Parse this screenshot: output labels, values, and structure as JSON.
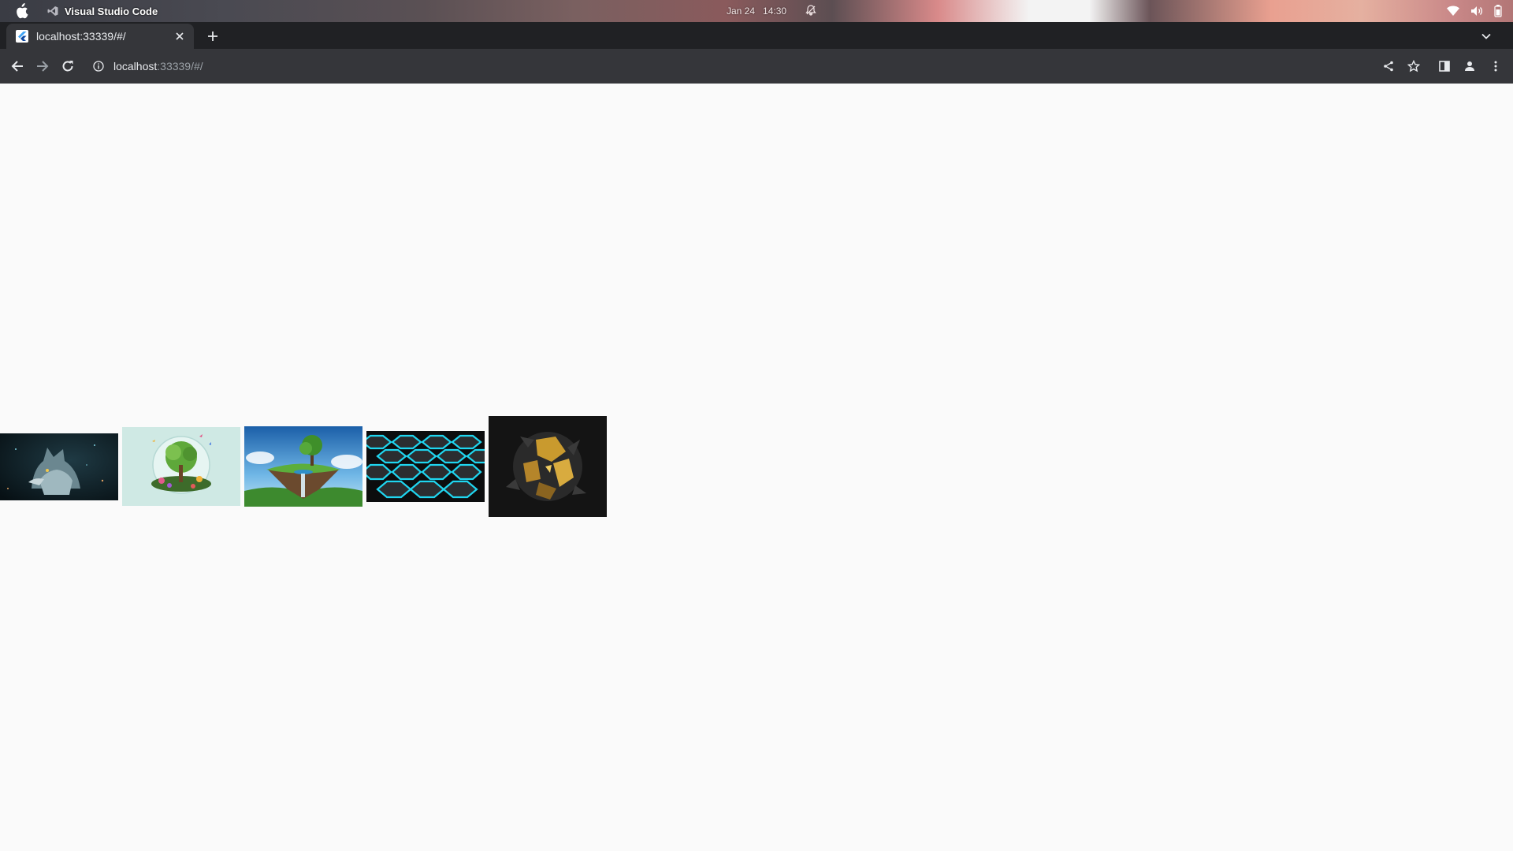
{
  "os_bar": {
    "app_name": "Visual Studio Code",
    "date": "Jan 24",
    "time": "14:30"
  },
  "browser": {
    "tab": {
      "title": "localhost:33339/#/"
    },
    "address": {
      "host": "localhost",
      "rest": ":33339/#/"
    }
  },
  "gallery": {
    "images": [
      {
        "subject": "wolf"
      },
      {
        "subject": "terrarium-globe"
      },
      {
        "subject": "floating-island"
      },
      {
        "subject": "hexagon-pattern"
      },
      {
        "subject": "golden-sphere"
      }
    ]
  },
  "colors": {
    "tab_strip": "#202124",
    "toolbar": "#35363a",
    "page_background": "#fafafa",
    "hex_glow": "#1fd6f0",
    "gold": "#c99a2e"
  }
}
